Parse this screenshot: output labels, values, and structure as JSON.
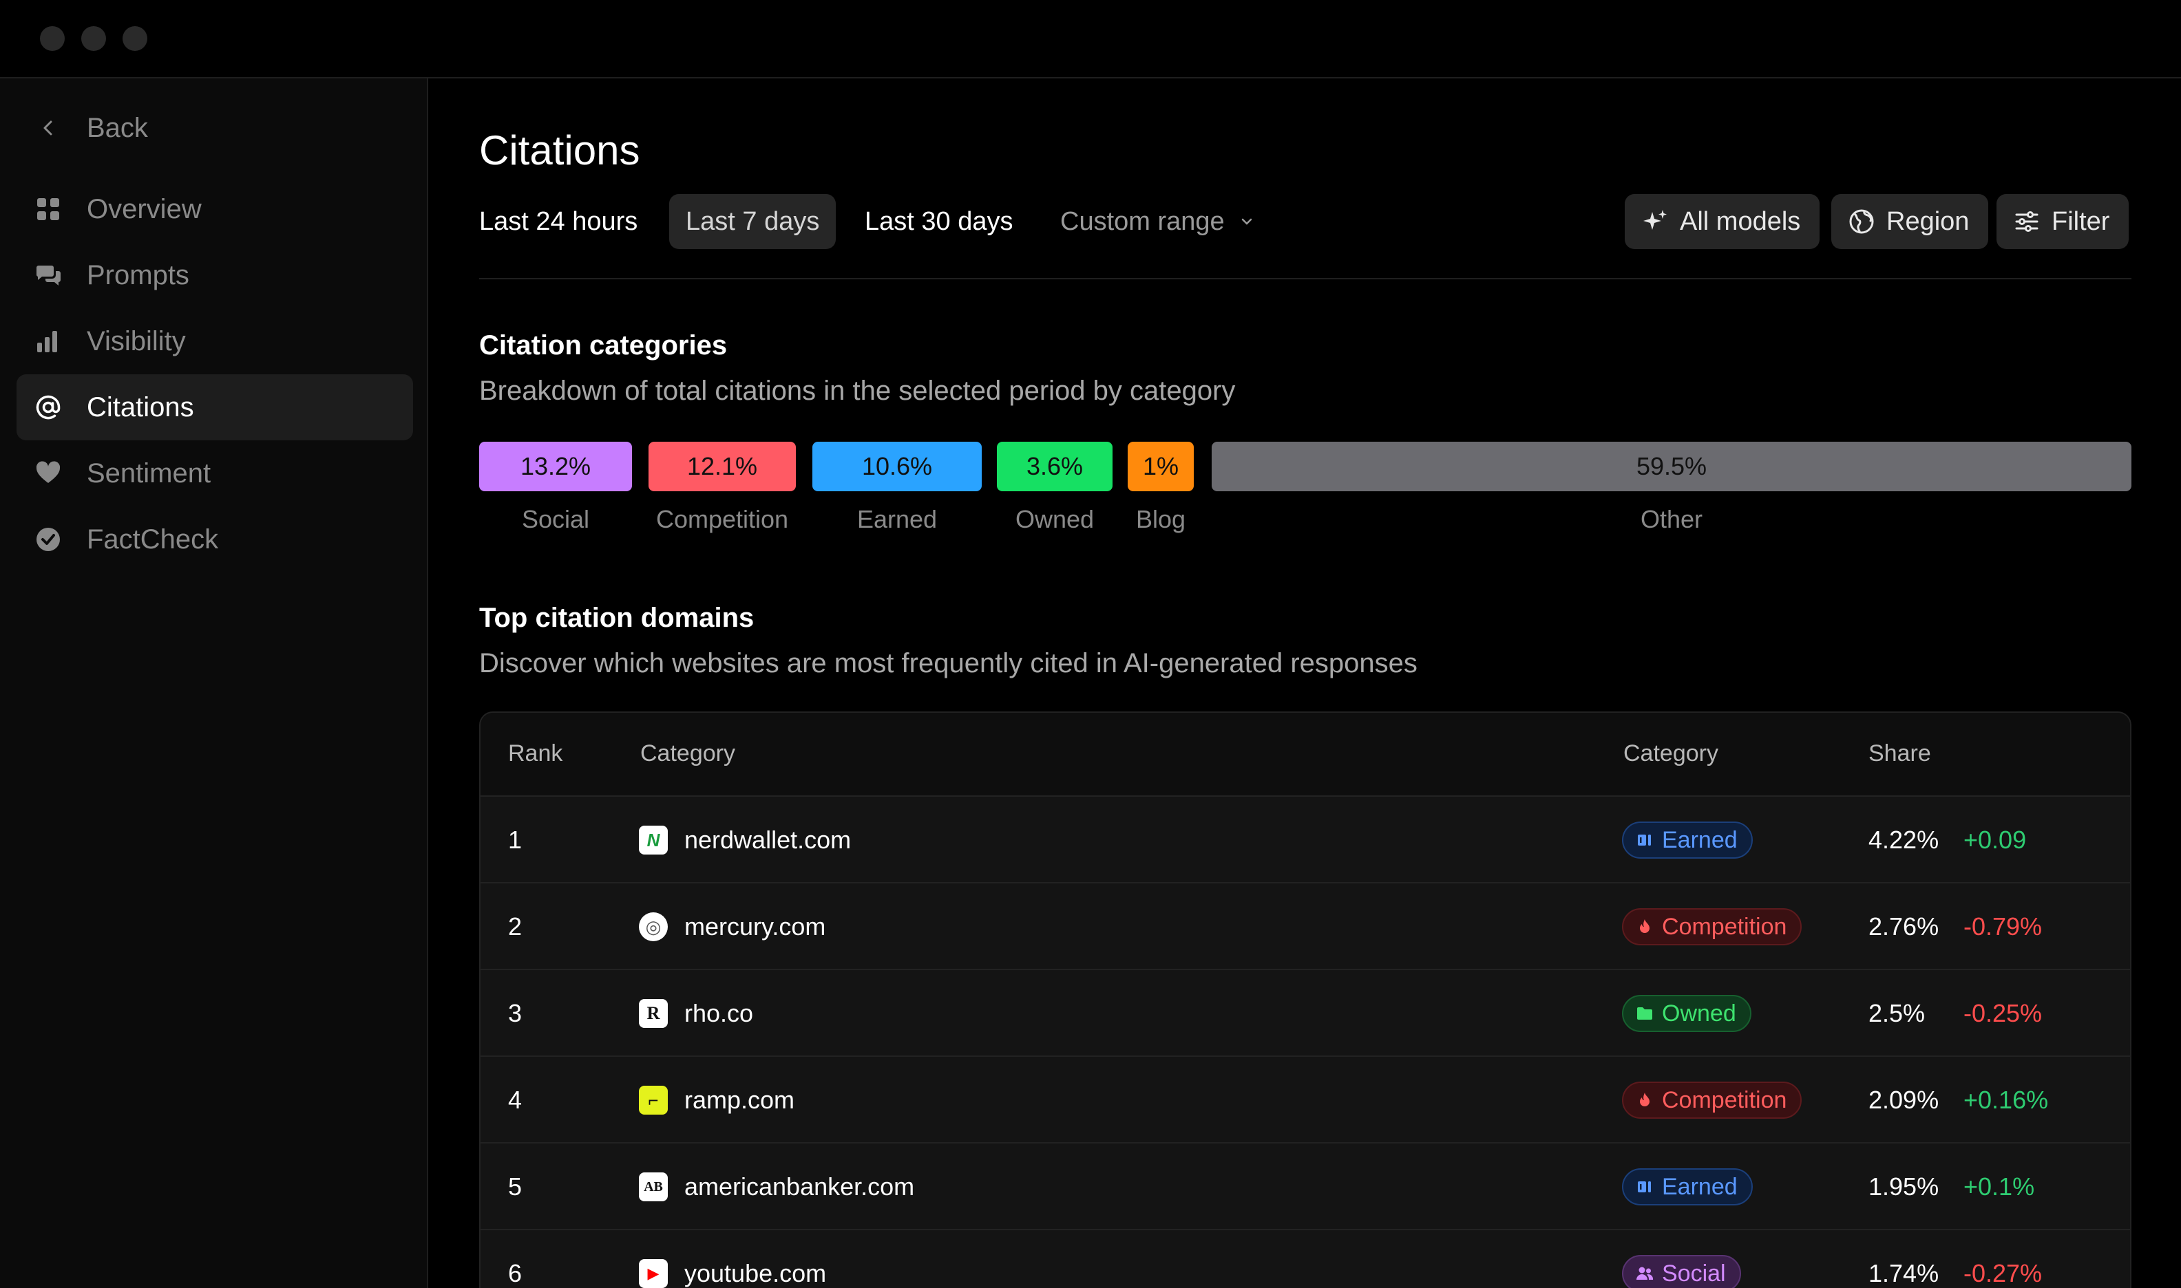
{
  "nav": {
    "back": "Back",
    "items": [
      {
        "label": "Overview",
        "icon": "grid-icon"
      },
      {
        "label": "Prompts",
        "icon": "chat-bubbles-icon"
      },
      {
        "label": "Visibility",
        "icon": "bar-chart-icon"
      },
      {
        "label": "Citations",
        "icon": "at-sign-icon",
        "active": true
      },
      {
        "label": "Sentiment",
        "icon": "heart-icon"
      },
      {
        "label": "FactCheck",
        "icon": "check-badge-icon"
      }
    ]
  },
  "page": {
    "title": "Citations",
    "ranges": [
      "Last 24 hours",
      "Last 7 days",
      "Last 30 days",
      "Custom range"
    ],
    "active_range": "Last 7 days",
    "buttons": {
      "models": "All models",
      "region": "Region",
      "filter": "Filter"
    }
  },
  "categories": {
    "title": "Citation categories",
    "subtitle": "Breakdown of total citations in the selected period by category",
    "segments": [
      {
        "label": "Social",
        "value": "13.2%",
        "color": "#c77dff"
      },
      {
        "label": "Competition",
        "value": "12.1%",
        "color": "#ff5a64"
      },
      {
        "label": "Earned",
        "value": "10.6%",
        "color": "#2aa3ff"
      },
      {
        "label": "Owned",
        "value": "3.6%",
        "color": "#16e063"
      },
      {
        "label": "Blog",
        "value": "1%",
        "color": "#ff8a0c"
      },
      {
        "label": "Other",
        "value": "59.5%",
        "color": "#6b6b70"
      }
    ]
  },
  "domains": {
    "title": "Top citation domains",
    "subtitle": "Discover which websites are most frequently cited in AI-generated responses",
    "headers": {
      "rank": "Rank",
      "domain": "Category",
      "category": "Category",
      "share": "Share"
    },
    "rows": [
      {
        "rank": "1",
        "domain": "nerdwallet.com",
        "favicon": "N",
        "category": "Earned",
        "share": "4.22%",
        "delta": "+0.09"
      },
      {
        "rank": "2",
        "domain": "mercury.com",
        "favicon": "◎",
        "category": "Competition",
        "share": "2.76%",
        "delta": "-0.79%"
      },
      {
        "rank": "3",
        "domain": "rho.co",
        "favicon": "R",
        "category": "Owned",
        "share": "2.5%",
        "delta": "-0.25%"
      },
      {
        "rank": "4",
        "domain": "ramp.com",
        "favicon": "⌐",
        "category": "Competition",
        "share": "2.09%",
        "delta": "+0.16%"
      },
      {
        "rank": "5",
        "domain": "americanbanker.com",
        "favicon": "AB",
        "category": "Earned",
        "share": "1.95%",
        "delta": "+0.1%"
      },
      {
        "rank": "6",
        "domain": "youtube.com",
        "favicon": "▶",
        "category": "Social",
        "share": "1.74%",
        "delta": "-0.27%"
      }
    ]
  }
}
